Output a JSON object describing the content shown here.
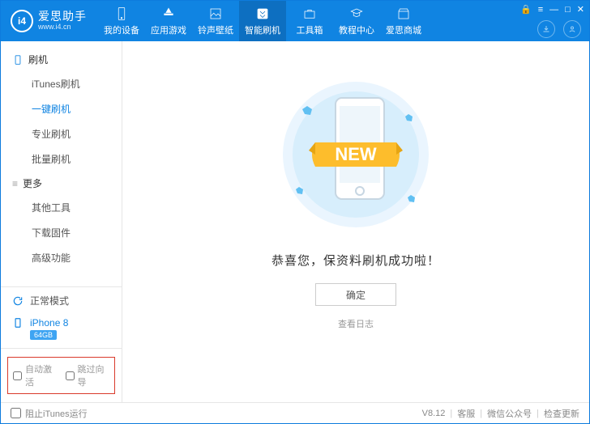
{
  "brand": {
    "cn": "爱思助手",
    "url": "www.i4.cn",
    "mark": "i4"
  },
  "nav": {
    "items": [
      {
        "label": "我的设备"
      },
      {
        "label": "应用游戏"
      },
      {
        "label": "铃声壁纸"
      },
      {
        "label": "智能刷机"
      },
      {
        "label": "工具箱"
      },
      {
        "label": "教程中心"
      },
      {
        "label": "爱思商城"
      }
    ]
  },
  "sidebar": {
    "group1": {
      "title": "刷机",
      "items": [
        "iTunes刷机",
        "一键刷机",
        "专业刷机",
        "批量刷机"
      ]
    },
    "group2": {
      "title": "更多",
      "items": [
        "其他工具",
        "下载固件",
        "高级功能"
      ]
    },
    "mode": "正常模式",
    "device": "iPhone 8",
    "storage": "64GB",
    "auto_activate": "自动激活",
    "skip_guide": "跳过向导"
  },
  "main": {
    "new_label": "NEW",
    "success_msg": "恭喜您，保资料刷机成功啦！",
    "ok": "确定",
    "view_log": "查看日志"
  },
  "footer": {
    "block_itunes": "阻止iTunes运行",
    "version": "V8.12",
    "support": "客服",
    "wechat": "微信公众号",
    "update": "检查更新"
  }
}
